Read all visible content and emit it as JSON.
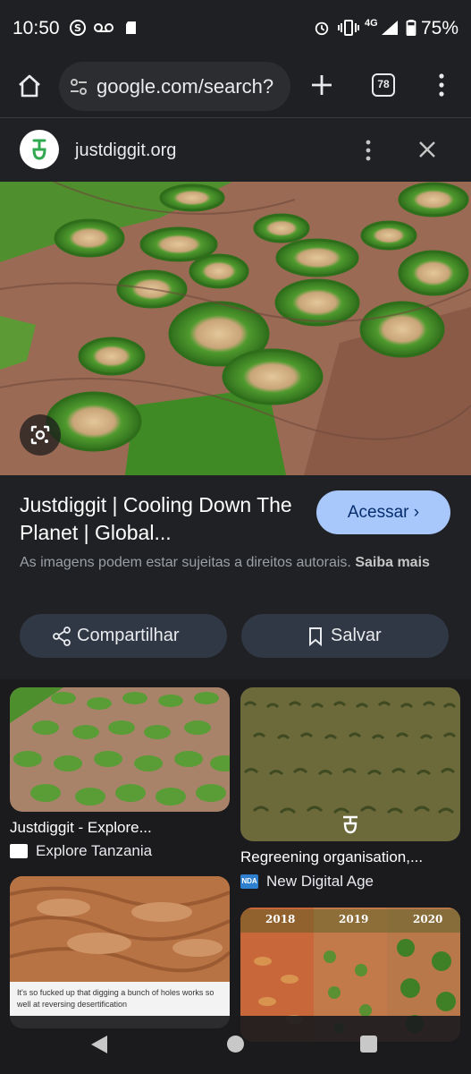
{
  "status_bar": {
    "time": "10:50",
    "battery": "75%",
    "network": "4G",
    "icons": [
      "skype-icon",
      "voicemail-icon",
      "sd-card-icon",
      "alarm-icon",
      "vibrate-icon",
      "signal-icon",
      "battery-icon"
    ]
  },
  "browser": {
    "url": "google.com/search?",
    "tab_count": "78"
  },
  "site": {
    "name": "justdiggit.org"
  },
  "result": {
    "title": "Justdiggit | Cooling Down The Planet | Global...",
    "visit_label": "Acessar",
    "copyright_text": "As imagens podem estar sujeitas a direitos autorais.",
    "learn_more": "Saiba mais",
    "share_label": "Compartilhar",
    "save_label": "Salvar"
  },
  "related": [
    {
      "title": "Justdiggit - Explore...",
      "source": "Explore Tanzania"
    },
    {
      "title": "Regreening organisation,...",
      "source": "New Digital Age",
      "source_badge": "NDA"
    },
    {
      "caption": "It's so fucked up that digging a bunch of holes works so well at reversing desertification"
    },
    {
      "years": [
        "2018",
        "2019",
        "2020"
      ]
    }
  ],
  "colors": {
    "background": "#202124",
    "accent_button": "#a8c7fa",
    "secondary_button": "#303845"
  }
}
